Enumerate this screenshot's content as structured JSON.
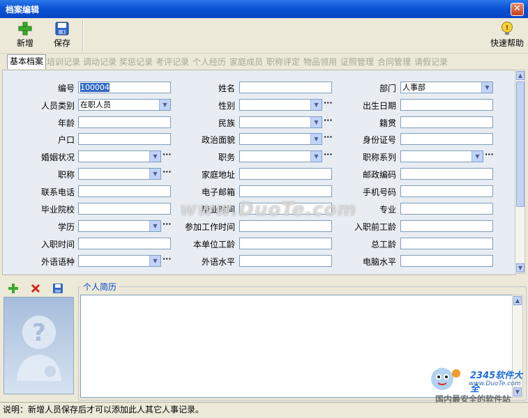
{
  "window": {
    "title": "档案编辑",
    "close_label": "✕"
  },
  "toolbar": {
    "new_label": "新增",
    "save_label": "保存",
    "help_label": "快速帮助"
  },
  "tabs": [
    "基本档案",
    "培训记录",
    "调动记录",
    "奖惩记录",
    "考评记录",
    "个人经历",
    "家庭成员",
    "职称评定",
    "物品领用",
    "证照管理",
    "合同管理",
    "请假记录"
  ],
  "form": {
    "col1": [
      {
        "label": "编号",
        "value": "100004",
        "type": "text"
      },
      {
        "label": "人员类别",
        "value": "在职人员",
        "type": "select"
      },
      {
        "label": "年龄",
        "value": "",
        "type": "text"
      },
      {
        "label": "户口",
        "value": "",
        "type": "text"
      },
      {
        "label": "婚姻状况",
        "value": "",
        "type": "select-dots"
      },
      {
        "label": "职称",
        "value": "",
        "type": "select-dots"
      },
      {
        "label": "联系电话",
        "value": "",
        "type": "text"
      },
      {
        "label": "毕业院校",
        "value": "",
        "type": "text"
      },
      {
        "label": "学历",
        "value": "",
        "type": "select-dots"
      },
      {
        "label": "入职时间",
        "value": "",
        "type": "text"
      },
      {
        "label": "外语语种",
        "value": "",
        "type": "select-dots"
      }
    ],
    "col2": [
      {
        "label": "姓名",
        "value": "",
        "type": "text"
      },
      {
        "label": "性别",
        "value": "",
        "type": "select-dots"
      },
      {
        "label": "民族",
        "value": "",
        "type": "select-dots"
      },
      {
        "label": "政治面貌",
        "value": "",
        "type": "select-dots"
      },
      {
        "label": "职务",
        "value": "",
        "type": "select-dots"
      },
      {
        "label": "家庭地址",
        "value": "",
        "type": "text"
      },
      {
        "label": "电子邮箱",
        "value": "",
        "type": "text"
      },
      {
        "label": "毕业时间",
        "value": "",
        "type": "text"
      },
      {
        "label": "参加工作时间",
        "value": "",
        "type": "text"
      },
      {
        "label": "本单位工龄",
        "value": "",
        "type": "text"
      },
      {
        "label": "外语水平",
        "value": "",
        "type": "text"
      }
    ],
    "col3": [
      {
        "label": "部门",
        "value": "人事部",
        "type": "select"
      },
      {
        "label": "出生日期",
        "value": "",
        "type": "text"
      },
      {
        "label": "籍贯",
        "value": "",
        "type": "text"
      },
      {
        "label": "身份证号",
        "value": "",
        "type": "text"
      },
      {
        "label": "职称系列",
        "value": "",
        "type": "select-dots"
      },
      {
        "label": "邮政编码",
        "value": "",
        "type": "text"
      },
      {
        "label": "手机号码",
        "value": "",
        "type": "text"
      },
      {
        "label": "专业",
        "value": "",
        "type": "text"
      },
      {
        "label": "入职前工龄",
        "value": "",
        "type": "text"
      },
      {
        "label": "总工龄",
        "value": "",
        "type": "text"
      },
      {
        "label": "电脑水平",
        "value": "",
        "type": "text"
      }
    ]
  },
  "resume": {
    "title": "个人简历",
    "value": ""
  },
  "status": {
    "text": "说明：新增人员保存后才可以添加此人其它人事记录。"
  },
  "watermark": {
    "text": "www.DuoTe.com"
  },
  "brand": {
    "line1": "2345软件大全",
    "line2": "www.DuoTe.com",
    "line3": "国内最安全的软件站"
  },
  "colors": {
    "titlebar": "#0A54D6",
    "panel": "#E8EDF3",
    "window_bg": "#ECE9D8",
    "input_border": "#7F9DB9",
    "selected_highlight": "#316AC5"
  }
}
